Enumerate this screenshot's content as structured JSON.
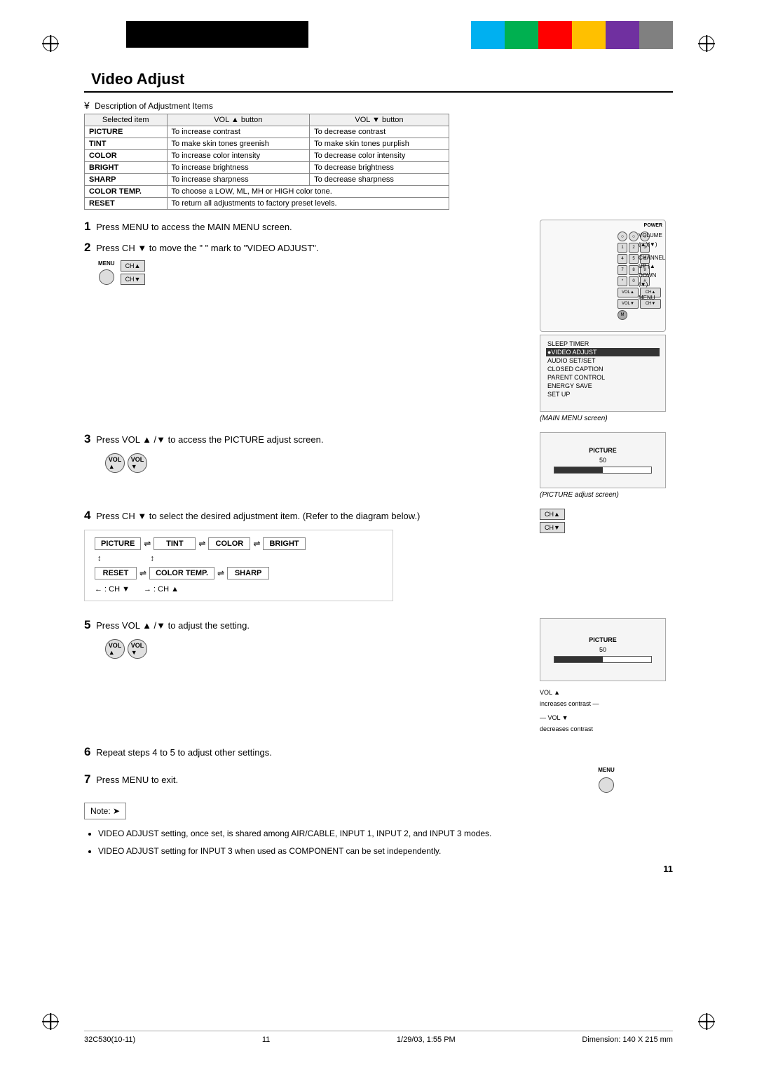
{
  "page": {
    "title": "Video Adjust",
    "page_number": "11",
    "doc_code": "32C530(10-11)",
    "date": "1/29/03, 1:55 PM",
    "dimension": "Dimension: 140 X 215 mm"
  },
  "color_blocks": [
    "#00b0f0",
    "#00b050",
    "#ff0000",
    "#ffc000",
    "#7030a0",
    "#808080"
  ],
  "adj_table": {
    "header": "Description of Adjustment Items",
    "columns": [
      "Selected item",
      "VOL ▲ button",
      "VOL ▼ button"
    ],
    "rows": [
      [
        "PICTURE",
        "To increase contrast",
        "To decrease contrast"
      ],
      [
        "TINT",
        "To make skin tones greenish",
        "To make skin tones purplish"
      ],
      [
        "COLOR",
        "To increase color intensity",
        "To decrease color intensity"
      ],
      [
        "BRIGHT",
        "To increase brightness",
        "To decrease brightness"
      ],
      [
        "SHARP",
        "To increase sharpness",
        "To decrease sharpness"
      ],
      [
        "COLOR TEMP.",
        "To choose a LOW, ML, MH or HIGH color tone.",
        ""
      ],
      [
        "RESET",
        "To return all adjustments to factory preset levels.",
        ""
      ]
    ]
  },
  "steps": [
    {
      "num": "1",
      "text": "Press MENU to access the MAIN MENU screen."
    },
    {
      "num": "2",
      "text": "Press CH ▼  to move the \" \" mark to \"VIDEO ADJUST\".",
      "screen_label": "(MAIN MENU screen)"
    },
    {
      "num": "3",
      "text": "Press VOL ▲ /▼  to access the PICTURE adjust screen.",
      "screen_label": "(PICTURE adjust screen)"
    },
    {
      "num": "4",
      "text": "Press CH ▼  to select the desired adjustment item. (Refer to the diagram below.)"
    },
    {
      "num": "5",
      "text": "Press VOL ▲ /▼  to adjust the setting."
    },
    {
      "num": "6",
      "text": "Repeat steps 4 to 5 to adjust other settings."
    },
    {
      "num": "7",
      "text": "Press MENU to exit."
    }
  ],
  "diagram": {
    "row1": [
      "PICTURE",
      "←→",
      "TINT",
      "←→",
      "COLOR",
      "←→",
      "BRIGHT"
    ],
    "row2": [
      "RESET",
      "←→",
      "COLOR TEMP.",
      "←→",
      "SHARP"
    ],
    "ch_left": "← : CH ▼",
    "ch_right": "→ : CH ▲"
  },
  "menu_items": [
    "SLEEP TIMER",
    "●VIDEO ADJUST",
    "AUDIO SET/SET",
    "CLOSED CAPTION",
    "PARENT CONTROL",
    "ENERGY SAVE",
    "SET UP"
  ],
  "remote_labels": {
    "volume": "VOLUME\n(▲)(▼)",
    "channel": "CHANNEL\nUP (▲\nDOWN (▼)",
    "menu": "MENU"
  },
  "picture_screen": {
    "label": "PICTURE",
    "value": "50"
  },
  "vol_labels": {
    "vol_up": "VOL ▲\nincreases contrast",
    "vol_down": "VOL ▼\ndecreases contrast"
  },
  "note": {
    "label": "Note:",
    "bullets": [
      "VIDEO ADJUST setting, once set, is shared among AIR/CABLE, INPUT 1, INPUT 2, and INPUT 3 modes.",
      "VIDEO ADJUST setting for INPUT 3 when used as COMPONENT can be set independently."
    ]
  },
  "page_end_number": "11"
}
